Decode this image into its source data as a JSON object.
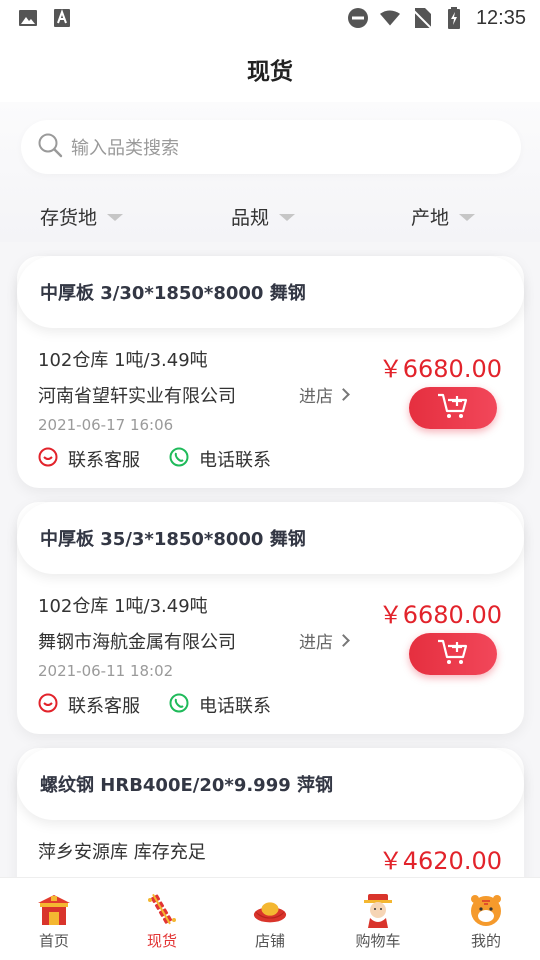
{
  "status_bar": {
    "time": "12:35",
    "left_icons": [
      "image-icon",
      "text-a-icon"
    ],
    "right_icons": [
      "do-not-disturb-icon",
      "wifi-icon",
      "no-sim-icon",
      "battery-charging-icon"
    ]
  },
  "header": {
    "title": "现货"
  },
  "search": {
    "placeholder": "输入品类搜索"
  },
  "filters": [
    {
      "label": "存货地"
    },
    {
      "label": "品规"
    },
    {
      "label": "产地"
    }
  ],
  "colors": {
    "accent": "#e2232b",
    "price": "#e2232b",
    "cart_button": "#ec3a4c",
    "active_tab": "#e23535"
  },
  "listings": [
    {
      "name": "中厚板 3/30*1850*8000 舞钢",
      "stock": "102仓库  1吨/3.49吨",
      "company": "河南省望轩实业有限公司",
      "store_link": "进店",
      "date": "2021-06-17 16:06",
      "price": "￥6680.00",
      "service_label": "联系客服",
      "phone_label": "电话联系"
    },
    {
      "name": "中厚板 35/3*1850*8000 舞钢",
      "stock": "102仓库  1吨/3.49吨",
      "company": "舞钢市海航金属有限公司",
      "store_link": "进店",
      "date": "2021-06-11 18:02",
      "price": "￥6680.00",
      "service_label": "联系客服",
      "phone_label": "电话联系"
    },
    {
      "name": "螺纹钢 HRB400E/20*9.999 萍钢",
      "stock": "萍乡安源库  库存充足",
      "price": "￥4620.00"
    }
  ],
  "tabs": [
    {
      "label": "首页",
      "icon": "home-gate-icon",
      "active": false
    },
    {
      "label": "现货",
      "icon": "firecracker-icon",
      "active": true
    },
    {
      "label": "店铺",
      "icon": "gold-ingot-icon",
      "active": false
    },
    {
      "label": "购物车",
      "icon": "fortune-god-icon",
      "active": false
    },
    {
      "label": "我的",
      "icon": "tiger-icon",
      "active": false
    }
  ]
}
